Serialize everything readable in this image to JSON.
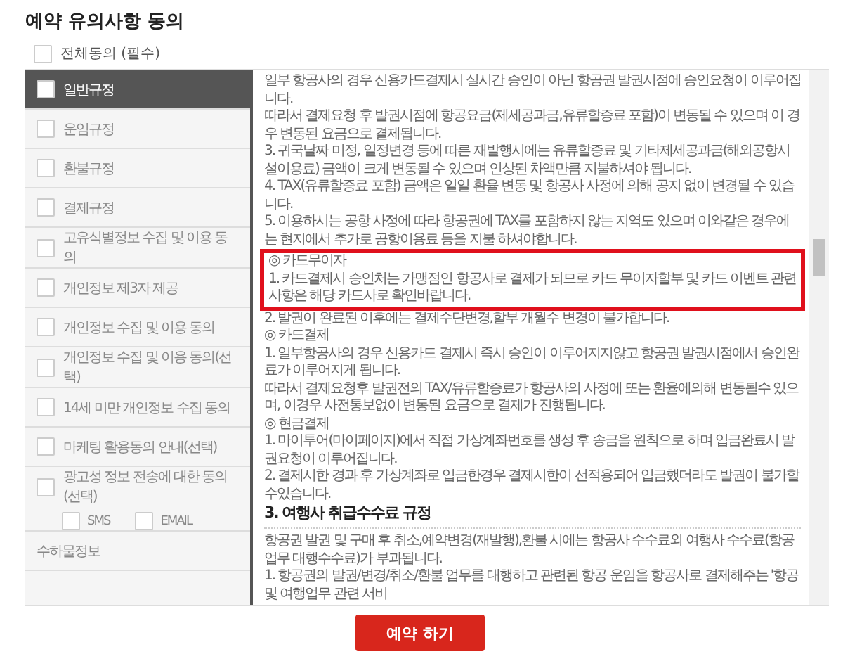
{
  "title": "예약 유의사항 동의",
  "all_agree": {
    "label": "전체동의 (필수)",
    "checked": false
  },
  "sections": [
    {
      "kind": "checkbox",
      "label": "일반규정",
      "selected": true,
      "checked": false
    },
    {
      "kind": "checkbox",
      "label": "운임규정",
      "selected": false,
      "checked": false
    },
    {
      "kind": "checkbox",
      "label": "환불규정",
      "selected": false,
      "checked": false
    },
    {
      "kind": "checkbox",
      "label": "결제규정",
      "selected": false,
      "checked": false
    },
    {
      "kind": "checkbox",
      "label": "고유식별정보 수집 및 이용 동의",
      "selected": false,
      "checked": false
    },
    {
      "kind": "checkbox",
      "label": "개인정보 제3자 제공",
      "selected": false,
      "checked": false
    },
    {
      "kind": "checkbox",
      "label": "개인정보 수집 및 이용 동의",
      "selected": false,
      "checked": false
    },
    {
      "kind": "checkbox",
      "label": "개인정보 수집 및 이용 동의(선택)",
      "selected": false,
      "checked": false
    },
    {
      "kind": "checkbox",
      "label": "14세 미만 개인정보 수집 동의",
      "selected": false,
      "checked": false
    },
    {
      "kind": "checkbox",
      "label": "마케팅 활용동의 안내(선택)",
      "selected": false,
      "checked": false
    },
    {
      "kind": "checkbox",
      "label": "광고성 정보 전송에 대한 동의(선택)",
      "selected": false,
      "checked": false,
      "options": [
        {
          "label": "SMS",
          "checked": false
        },
        {
          "label": "EMAIL",
          "checked": false
        }
      ]
    },
    {
      "kind": "plain",
      "label": "수하물정보",
      "selected": false
    }
  ],
  "content": [
    {
      "kind": "text",
      "text": "일부 항공사의 경우 신용카드결제시 실시간 승인이 아닌 항공권 발권시점에 승인요청이 이루어집니다."
    },
    {
      "kind": "text",
      "text": "따라서 결제요청 후 발권시점에 항공요금(제세공과금,유류할증료 포함)이 변동될 수 있으며 이 경우 변동된 요금으로 결제됩니다."
    },
    {
      "kind": "text",
      "text": "3. 귀국날짜 미정, 일정변경 등에 따른 재발행시에는 유류할증료 및 기타제세공과금(해외공항시설이용료) 금액이 크게 변동될 수 있으며 인상된 차액만큼 지불하셔야 됩니다."
    },
    {
      "kind": "text",
      "text": "4. TAX(유류할증료 포함) 금액은 일일 환율 변동 및 항공사 사정에 의해 공지 없이 변경될 수 있습니다."
    },
    {
      "kind": "text",
      "text": "5. 이용하시는 공항 사정에 따라 항공권에 TAX를 포함하지 않는 지역도 있으며 이와같은 경우에는 현지에서 추가로 공항이용료 등을 지불 하셔야합니다."
    },
    {
      "kind": "notice",
      "lines": [
        "◎ 카드무이자",
        "1. 카드결제시 승인처는 가맹점인 항공사로 결제가 되므로 카드 무이자할부 및 카드 이벤트 관련사항은 해당 카드사로 확인바랍니다."
      ]
    },
    {
      "kind": "text",
      "text": "2. 발권이 완료된 이후에는 결제수단변경,할부 개월수 변경이 불가합니다."
    },
    {
      "kind": "text",
      "text": "◎ 카드결제"
    },
    {
      "kind": "text",
      "text": "1. 일부항공사의 경우 신용카드 결제시 즉시 승인이 이루어지지않고 항공권 발권시점에서 승인완료가 이루어지게 됩니다."
    },
    {
      "kind": "text",
      "text": "따라서 결제요청후 발권전의 TAX/유류할증료가 항공사의 사정에 또는 환율에의해 변동될수 있으며, 이경우 사전통보없이 변동된 요금으로 결제가 진행됩니다."
    },
    {
      "kind": "text",
      "text": "◎ 현금결제"
    },
    {
      "kind": "text",
      "text": "1. 마이투어(마이페이지)에서 직접 가상계좌번호를 생성 후 송금을 원칙으로 하며 입금완료시 발권요청이 이루어집니다."
    },
    {
      "kind": "text",
      "text": "2. 결제시한 경과 후 가상계좌로 입금한경우 결제시한이 선적용되어 입금했더라도 발권이 불가할수있습니다."
    },
    {
      "kind": "heading",
      "text": "3. 여행사 취급수수료 규정"
    },
    {
      "kind": "text",
      "text": "항공권 발권 및 구매 후 취소,예약변경(재발행),환불 시에는 항공사 수수료외 여행사 수수료(항공업무 대행수수료)가 부과됩니다."
    },
    {
      "kind": "text",
      "text": "1. 항공권의 발권/변경/취소/환불 업무를 대행하고 관련된 항공 운임을 항공사로 결제해주는 '항공 및 여행업무 관련 서비"
    }
  ],
  "button": "예약 하기"
}
